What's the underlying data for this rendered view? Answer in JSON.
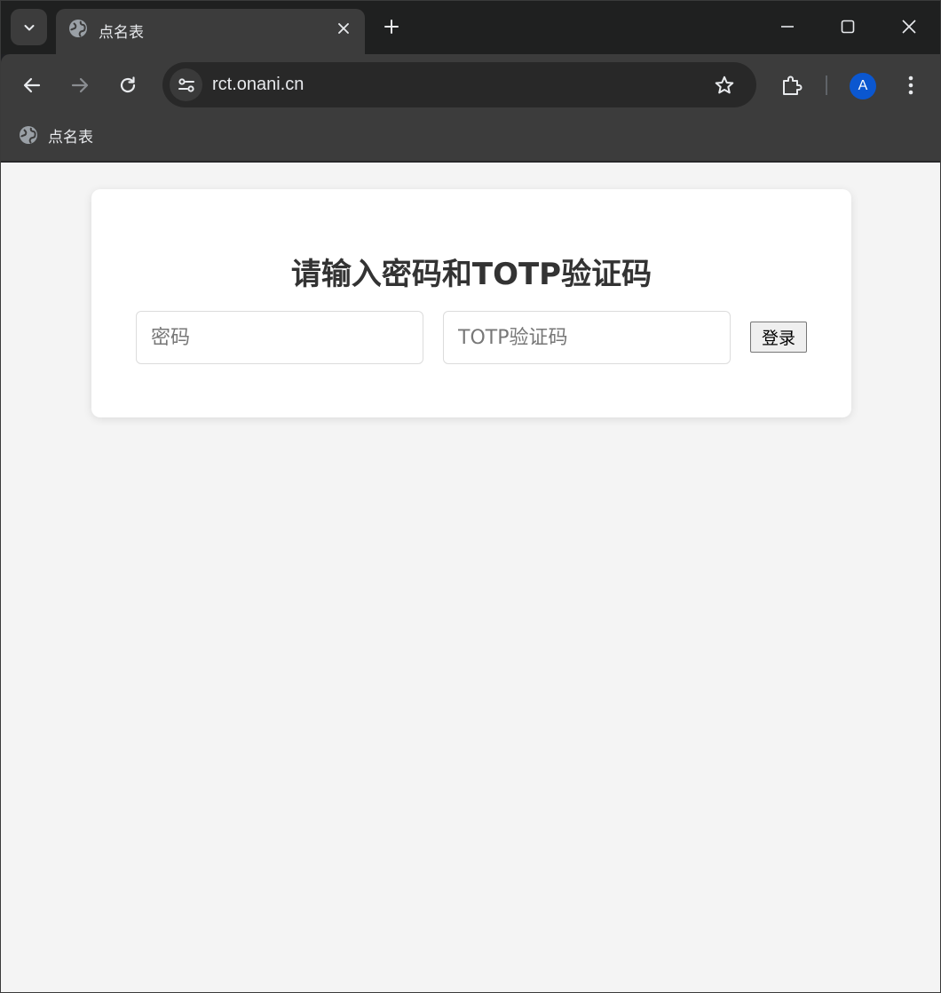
{
  "browser": {
    "tab": {
      "title": "点名表"
    },
    "address_bar": {
      "url": "rct.onani.cn"
    },
    "bookmarks": [
      {
        "label": "点名表"
      }
    ],
    "profile": {
      "initial": "A",
      "color": "#0b57d0"
    }
  },
  "page": {
    "heading": "请输入密码和TOTP验证码",
    "password_field": {
      "placeholder": "密码",
      "value": ""
    },
    "totp_field": {
      "placeholder": "TOTP验证码",
      "value": ""
    },
    "login_button": {
      "label": "登录"
    }
  },
  "icons": {
    "tab_search": "chevron-down-icon",
    "favicon": "globe-icon",
    "close_tab": "close-icon",
    "new_tab": "plus-icon",
    "minimize": "minimize-icon",
    "maximize": "maximize-icon",
    "close_window": "close-icon",
    "back": "arrow-left-icon",
    "forward": "arrow-right-icon",
    "reload": "reload-icon",
    "site_info": "tune-icon",
    "bookmark": "star-icon",
    "extensions": "puzzle-icon",
    "menu": "kebab-menu-icon"
  },
  "colors": {
    "page_background": "#f4f4f4",
    "card_background": "#ffffff",
    "heading": "#333333",
    "browser_chrome": "#3c3c3c"
  }
}
